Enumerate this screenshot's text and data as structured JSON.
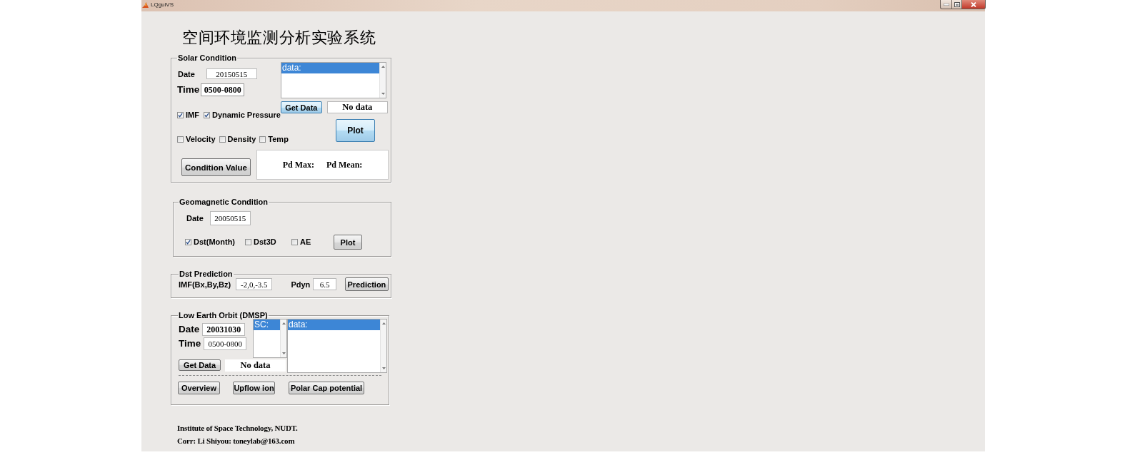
{
  "window": {
    "title": "LQguiVS"
  },
  "heading": "空间环境监测分析实验系统",
  "solar_condition": {
    "title": "Solar Condition",
    "date": {
      "label": "Date",
      "value": "20150515"
    },
    "time": {
      "label": "Time",
      "value": "0500-0800"
    },
    "data_list": [
      {
        "text": "data:",
        "selected": true
      }
    ],
    "get_data_button": {
      "label": "Get Data",
      "highlighted": true
    },
    "status": "No data",
    "checkbox_rows": [
      [
        {
          "label": "IMF",
          "checked": true
        },
        {
          "label": "Dynamic Pressure",
          "checked": true
        }
      ],
      [
        {
          "label": "Velocity",
          "checked": false
        },
        {
          "label": "Density",
          "checked": false
        },
        {
          "label": "Temp",
          "checked": false
        }
      ]
    ],
    "plot_button": {
      "label": "Plot",
      "highlighted": true
    },
    "condition_value_button": {
      "label": "Condition Value",
      "highlighted": false
    },
    "results": [
      "Pd Max:",
      "Pd Mean:"
    ]
  },
  "geomagnetic_condition": {
    "title": "Geomagnetic Condition",
    "date": {
      "label": "Date",
      "value": "20050515"
    },
    "checkboxes": [
      {
        "label": "Dst(Month)",
        "checked": true
      },
      {
        "label": "Dst3D",
        "checked": false
      },
      {
        "label": "AE",
        "checked": false
      }
    ],
    "plot_button": {
      "label": "Plot",
      "highlighted": false
    }
  },
  "dst_prediction": {
    "title": "Dst Prediction",
    "imf": {
      "label": "IMF(Bx,By,Bz)",
      "value": "-2,0,-3.5"
    },
    "pdyn": {
      "label": "Pdyn",
      "value": "6.5"
    },
    "prediction_button": {
      "label": "Prediction",
      "highlighted": false
    }
  },
  "low_earth_orbit": {
    "title": "Low Earth Orbit (DMSP)",
    "date": {
      "label": "Date",
      "value": "20031030"
    },
    "time": {
      "label": "Time",
      "value": "0500-0800"
    },
    "sc_list": [
      {
        "text": "SC:",
        "selected": true
      }
    ],
    "data_list": [
      {
        "text": "data:",
        "selected": true
      }
    ],
    "get_data_button": {
      "label": "Get Data",
      "highlighted": false
    },
    "status": "No data",
    "buttons": [
      {
        "label": "Overview",
        "highlighted": false
      },
      {
        "label": "Upflow ion",
        "highlighted": false
      },
      {
        "label": "Polar Cap potential",
        "highlighted": false
      }
    ]
  },
  "footer": [
    "Institute of Space Technology, NUDT.",
    "Corr: Li Shiyou: toneylab@163.com"
  ]
}
